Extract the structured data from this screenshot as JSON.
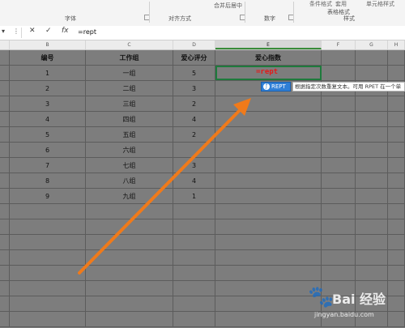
{
  "ribbon": {
    "partial_labels": [
      "条件格式",
      "套用",
      "单元格样式"
    ],
    "groups": [
      {
        "label": "字体",
        "name": "group-font"
      },
      {
        "label": "对齐方式",
        "name": "group-alignment"
      },
      {
        "label": "合并后居中",
        "name": "merge-center"
      },
      {
        "label": "数字",
        "name": "group-number"
      },
      {
        "label": "表格格式",
        "name": "table-format"
      },
      {
        "label": "样式",
        "name": "group-styles"
      }
    ]
  },
  "formula_bar": {
    "cancel": "✕",
    "confirm": "✓",
    "fx": "fx",
    "content": "=rept"
  },
  "columns": [
    "B",
    "C",
    "D",
    "E",
    "F",
    "G",
    "H"
  ],
  "active_column": "E",
  "table": {
    "headers": [
      "编号",
      "工作组",
      "爱心评分",
      "爱心指数"
    ],
    "rows": [
      [
        "1",
        "一组",
        "5",
        ""
      ],
      [
        "2",
        "二组",
        "3",
        ""
      ],
      [
        "3",
        "三组",
        "2",
        ""
      ],
      [
        "4",
        "四组",
        "4",
        ""
      ],
      [
        "5",
        "五组",
        "2",
        ""
      ],
      [
        "6",
        "六组",
        "",
        ""
      ],
      [
        "7",
        "七组",
        "3",
        ""
      ],
      [
        "8",
        "八组",
        "4",
        ""
      ],
      [
        "9",
        "九组",
        "1",
        ""
      ]
    ]
  },
  "editing_cell": {
    "text": "=rept"
  },
  "autocomplete": {
    "suggestion": "REPT",
    "tooltip": "根据指定次数重复文本。可用 RPET 在一个单"
  },
  "watermark": {
    "brand": "Bai 经验",
    "url": "jingyan.baidu.com"
  },
  "colors": {
    "grid_bg": "#7d7d7d",
    "selection_border": "#1e7a3c",
    "edit_text": "#e21b1b",
    "arrow": "#f07a1a",
    "suggestion_bg": "#2f7fd6"
  }
}
